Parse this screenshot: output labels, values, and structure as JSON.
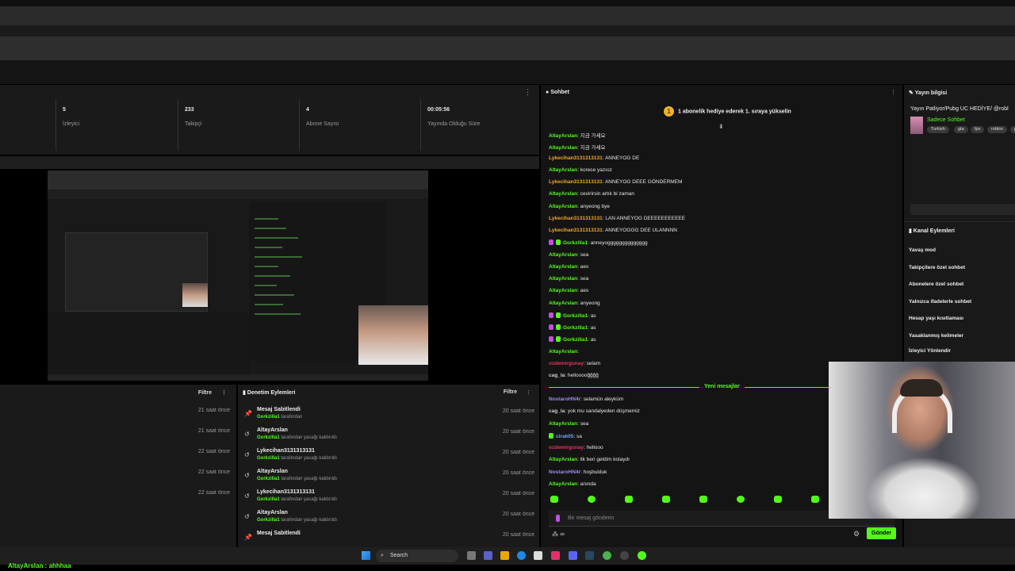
{
  "stats": [
    {
      "value": "5",
      "label": "İzleyici"
    },
    {
      "value": "233",
      "label": "Takipçi"
    },
    {
      "value": "4",
      "label": "Abone Sayısı"
    },
    {
      "value": "00:05:56",
      "label": "Yayında Olduğu Süre"
    }
  ],
  "left_panel": {
    "filter_label": "Filtre",
    "times": [
      "21 saat önce",
      "21 saat önce",
      "22 saat önce",
      "22 saat önce",
      "22 saat önce"
    ]
  },
  "moderation": {
    "title": "Denetim Eylemleri",
    "filter_label": "Filtre",
    "items": [
      {
        "icon": "pin",
        "name": "Mesaj Sabitlendi",
        "by": "Gorkzilla1",
        "action": " tarafından",
        "time": "20 saat önce"
      },
      {
        "icon": "undo",
        "name": "AltayArslan",
        "by": "Gorkzilla1",
        "action": " tarafından yasağı kaldırıldı",
        "time": "20 saat önce"
      },
      {
        "icon": "undo",
        "name": "Lykecihan3131313131",
        "by": "Gorkzilla1",
        "action": " tarafından yasağı kaldırıldı",
        "time": "20 saat önce"
      },
      {
        "icon": "undo",
        "name": "AltayArslan",
        "by": "Gorkzilla1",
        "action": " tarafından yasağı kaldırıldı",
        "time": "20 saat önce"
      },
      {
        "icon": "undo",
        "name": "Lykecihan3131313131",
        "by": "Gorkzilla1",
        "action": " tarafından yasağı kaldırıldı",
        "time": "20 saat önce"
      },
      {
        "icon": "undo",
        "name": "AltayArslan",
        "by": "Gorkzilla1",
        "action": " tarafından yasağı kaldırıldı",
        "time": "20 saat önce"
      },
      {
        "icon": "pin",
        "name": "Mesaj Sabitlendi",
        "by": "",
        "action": "",
        "time": "20 saat önce"
      }
    ]
  },
  "chat": {
    "title": "Sohbet",
    "pinned": "1 abonelik hediye ederek 1. sıraya yükselin",
    "new_messages_label": "Yeni mesajlar",
    "messages": [
      {
        "user": "AltayArslan",
        "color": "#53fc18",
        "text": ": 지금 가세요",
        "badges": []
      },
      {
        "user": "AltayArslan",
        "color": "#53fc18",
        "text": ": 지금 가세요",
        "badges": []
      },
      {
        "user": "Lykecihan3131313131",
        "color": "#f5a623",
        "text": ": ANNEYOG DE",
        "badges": []
      },
      {
        "user": "AltayArslan",
        "color": "#53fc18",
        "text": ": korece yazıoz",
        "badges": []
      },
      {
        "user": "Lykecihan3131313131",
        "color": "#f5a623",
        "text": ": ANNEYOG DEEE GÖNDERMEM",
        "badges": []
      },
      {
        "user": "AltayArslan",
        "color": "#53fc18",
        "text": ": cevirirsin artık bi zaman",
        "badges": []
      },
      {
        "user": "AltayArslan",
        "color": "#53fc18",
        "text": ": anyeong bye",
        "badges": []
      },
      {
        "user": "Lykecihan3131313131",
        "color": "#f5a623",
        "text": ": LAN ANNEYOG DEEEEEEEEEEE",
        "badges": []
      },
      {
        "user": "Lykecihan3131313131",
        "color": "#f5a623",
        "text": ": ANNEYOGGG DEE ULANNNN",
        "badges": []
      },
      {
        "user": "Gorkzilla1",
        "color": "#53fc18",
        "text": ": anneyogggggggggggggg",
        "badges": [
          "mic",
          "green"
        ]
      },
      {
        "user": "AltayArslan",
        "color": "#53fc18",
        "text": ": sea",
        "badges": []
      },
      {
        "user": "AltayArslan",
        "color": "#53fc18",
        "text": ": aes",
        "badges": []
      },
      {
        "user": "AltayArslan",
        "color": "#53fc18",
        "text": ": sea",
        "badges": []
      },
      {
        "user": "AltayArslan",
        "color": "#53fc18",
        "text": ": aes",
        "badges": []
      },
      {
        "user": "AltayArslan",
        "color": "#53fc18",
        "text": ": anyeong",
        "badges": []
      },
      {
        "user": "Gorkzilla1",
        "color": "#53fc18",
        "text": ": as",
        "badges": [
          "mic",
          "green"
        ]
      },
      {
        "user": "Gorkzilla1",
        "color": "#53fc18",
        "text": ": as",
        "badges": [
          "mic",
          "green"
        ]
      },
      {
        "user": "Gorkzilla1",
        "color": "#53fc18",
        "text": ": as",
        "badges": [
          "mic",
          "green"
        ]
      },
      {
        "user": "AltayArslan",
        "color": "#53fc18",
        "text": ":",
        "badges": []
      },
      {
        "user": "ozdemirgunay",
        "color": "#e8315c",
        "text": ": selam",
        "badges": []
      },
      {
        "user": "cag_la",
        "color": "#cfcfcf",
        "text": ": hellooooğğğğ",
        "badges": []
      }
    ],
    "new_messages": [
      {
        "user": "NostaroHN4r",
        "color": "#9b8cf5",
        "text": ": selamün aleyküm",
        "badges": []
      },
      {
        "user": "cag_la",
        "color": "#cfcfcf",
        "text": ": yok mu sandalyeden düşmemiz",
        "badges": []
      },
      {
        "user": "AltayArslan",
        "color": "#53fc18",
        "text": ": sea",
        "badges": []
      },
      {
        "user": "cirak05",
        "color": "#6aa9ff",
        "text": ": sa",
        "badges": [
          "green"
        ]
      },
      {
        "user": "ozdemirgunay",
        "color": "#e8315c",
        "text": ": hellooo",
        "badges": []
      },
      {
        "user": "AltayArslan",
        "color": "#53fc18",
        "text": ": ilk ben geldim kolaydı",
        "badges": []
      },
      {
        "user": "NostaroHN4r",
        "color": "#9b8cf5",
        "text": ": hoşbulduk",
        "badges": []
      },
      {
        "user": "AltayArslan",
        "color": "#53fc18",
        "text": ": anında",
        "badges": []
      }
    ],
    "input_placeholder": "Bir mesaj gönderin",
    "points_label": "∞",
    "send_label": "Gönder"
  },
  "stream_info": {
    "title": "Yayın bilgisi",
    "stream_title": "Yayın Patliyor/Pubg UC HEDİYE/ @robl",
    "category": "Sadece Sohbet",
    "tags": [
      "Turkish",
      "gta",
      "fps",
      "roblox",
      "p"
    ]
  },
  "channel_actions": {
    "title": "Kanal Eylemleri",
    "items": [
      "Yavaş mod",
      "Takipçilere özel sohbet",
      "Abonelere özel sohbet",
      "Yalnızca ifadelerle sohbet",
      "Hesap yaşı kısıtlaması",
      "Yasaklanmış kelimeler",
      "İzleyici Yönlendir"
    ]
  },
  "taskbar": {
    "search_label": "Search"
  },
  "bottom_strip_text": "AltayArslan : ahhhaa",
  "colors": {
    "accent": "#53fc18",
    "panel": "#1a1a1a"
  }
}
